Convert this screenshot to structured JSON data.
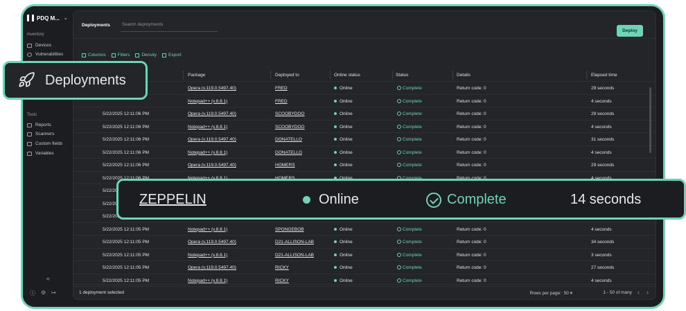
{
  "sidebar": {
    "brand": "PDQ M...",
    "inventory_label": "Inventory",
    "items": [
      {
        "label": "Devices",
        "icon": "monitor-icon"
      },
      {
        "label": "Vulnerabilities",
        "icon": "shield-icon"
      }
    ],
    "tools_label": "Tools",
    "tools": [
      {
        "label": "Reports",
        "icon": "reports-icon"
      },
      {
        "label": "Scanners",
        "icon": "scanner-icon"
      },
      {
        "label": "Custom fields",
        "icon": "custom-fields-icon"
      },
      {
        "label": "Variables",
        "icon": "variables-icon"
      }
    ]
  },
  "header": {
    "title": "Deployments",
    "search_placeholder": "Search deployments",
    "deploy_label": "Deploy"
  },
  "toolbar": {
    "columns": "Columns",
    "filters": "Filters",
    "density": "Density",
    "export": "Export"
  },
  "table": {
    "columns": [
      "Package",
      "Deployed to",
      "Online status",
      "Status",
      "Details",
      "Elapsed time"
    ],
    "rows": [
      {
        "date": "",
        "package": "Opera (v.119.0.5497.40)",
        "host": "FRED",
        "online": "Online",
        "status": "Complete",
        "details": "Return code: 0",
        "elapsed": "29 seconds"
      },
      {
        "date": "",
        "package": "Notepad++ (v.8.8.1)",
        "host": "FRED",
        "online": "Online",
        "status": "Complete",
        "details": "Return code: 0",
        "elapsed": "4 seconds"
      },
      {
        "date": "5/22/2025 12:11:06 PM",
        "package": "Opera (v.119.0.5497.40)",
        "host": "SCOOBYDOO",
        "online": "Online",
        "status": "Complete",
        "details": "Return code: 0",
        "elapsed": "29 seconds"
      },
      {
        "date": "5/22/2025 12:11:06 PM",
        "package": "Notepad++ (v.8.8.1)",
        "host": "SCOOBYDOO",
        "online": "Online",
        "status": "Complete",
        "details": "Return code: 0",
        "elapsed": "4 seconds"
      },
      {
        "date": "5/22/2025 12:11:06 PM",
        "package": "Opera (v.119.0.5497.40)",
        "host": "DONATELLO",
        "online": "Online",
        "status": "Complete",
        "details": "Return code: 0",
        "elapsed": "31 seconds"
      },
      {
        "date": "5/22/2025 12:11:06 PM",
        "package": "Notepad++ (v.8.8.1)",
        "host": "DONATELLO",
        "online": "Online",
        "status": "Complete",
        "details": "Return code: 0",
        "elapsed": "4 seconds"
      },
      {
        "date": "5/22/2025 12:11:06 PM",
        "package": "Opera (v.119.0.5497.40)",
        "host": "HOMERS",
        "online": "Online",
        "status": "Complete",
        "details": "Return code: 0",
        "elapsed": "29 seconds"
      },
      {
        "date": "5/22/2025 12:11:06 PM",
        "package": "Notepad++ (v.8.8.1)",
        "host": "HOMERS",
        "online": "Online",
        "status": "Complete",
        "details": "Return code: 0",
        "elapsed": "4 seconds"
      },
      {
        "date": "5/22/2025 12:11",
        "package": "",
        "host": "",
        "online": "",
        "status": "",
        "details": "",
        "elapsed": ""
      },
      {
        "date": "5/22/2025 12:11",
        "package": "",
        "host": "",
        "online": "",
        "status": "",
        "details": "",
        "elapsed": ""
      },
      {
        "date": "5/22/2025 12:11:0",
        "package": "",
        "host": "",
        "online": "",
        "status": "",
        "details": "",
        "elapsed": ""
      },
      {
        "date": "5/22/2025 12:11:05 PM",
        "package": "Notepad++ (v.8.8.1)",
        "host": "SPONGEBOB",
        "online": "Online",
        "status": "Complete",
        "details": "Return code: 0",
        "elapsed": "4 seconds"
      },
      {
        "date": "5/22/2025 12:11:05 PM",
        "package": "Opera (v.119.0.5497.40)",
        "host": "D21-ALLISON-LAB",
        "online": "Online",
        "status": "Complete",
        "details": "Return code: 0",
        "elapsed": "34 seconds"
      },
      {
        "date": "5/22/2025 12:11:05 PM",
        "package": "Notepad++ (v.8.8.1)",
        "host": "D21-ALLISON-LAB",
        "online": "Online",
        "status": "Complete",
        "details": "Return code: 0",
        "elapsed": "3 seconds"
      },
      {
        "date": "5/22/2025 12:11:05 PM",
        "package": "Opera (v.119.0.5497.40)",
        "host": "RICKY",
        "online": "Online",
        "status": "Complete",
        "details": "Return code: 0",
        "elapsed": "27 seconds"
      },
      {
        "date": "5/22/2025 12:11:05 PM",
        "package": "Notepad++ (v.8.8.1)",
        "host": "RICKY",
        "online": "Online",
        "status": "Complete",
        "details": "Return code: 0",
        "elapsed": "4 seconds"
      }
    ]
  },
  "footer": {
    "selected": "1 deployment selected",
    "rows_per_page_label": "Rows per page:",
    "rows_per_page_value": "50",
    "range": "1 - 50 of many"
  },
  "callout_nav": {
    "label": "Deployments",
    "icon": "rocket-icon"
  },
  "callout_row": {
    "host": "ZEPPELIN",
    "online": "Online",
    "status": "Complete",
    "elapsed": "14 seconds"
  },
  "colors": {
    "accent": "#6ed3b7",
    "background": "#1b1d20",
    "panel": "#232529"
  }
}
